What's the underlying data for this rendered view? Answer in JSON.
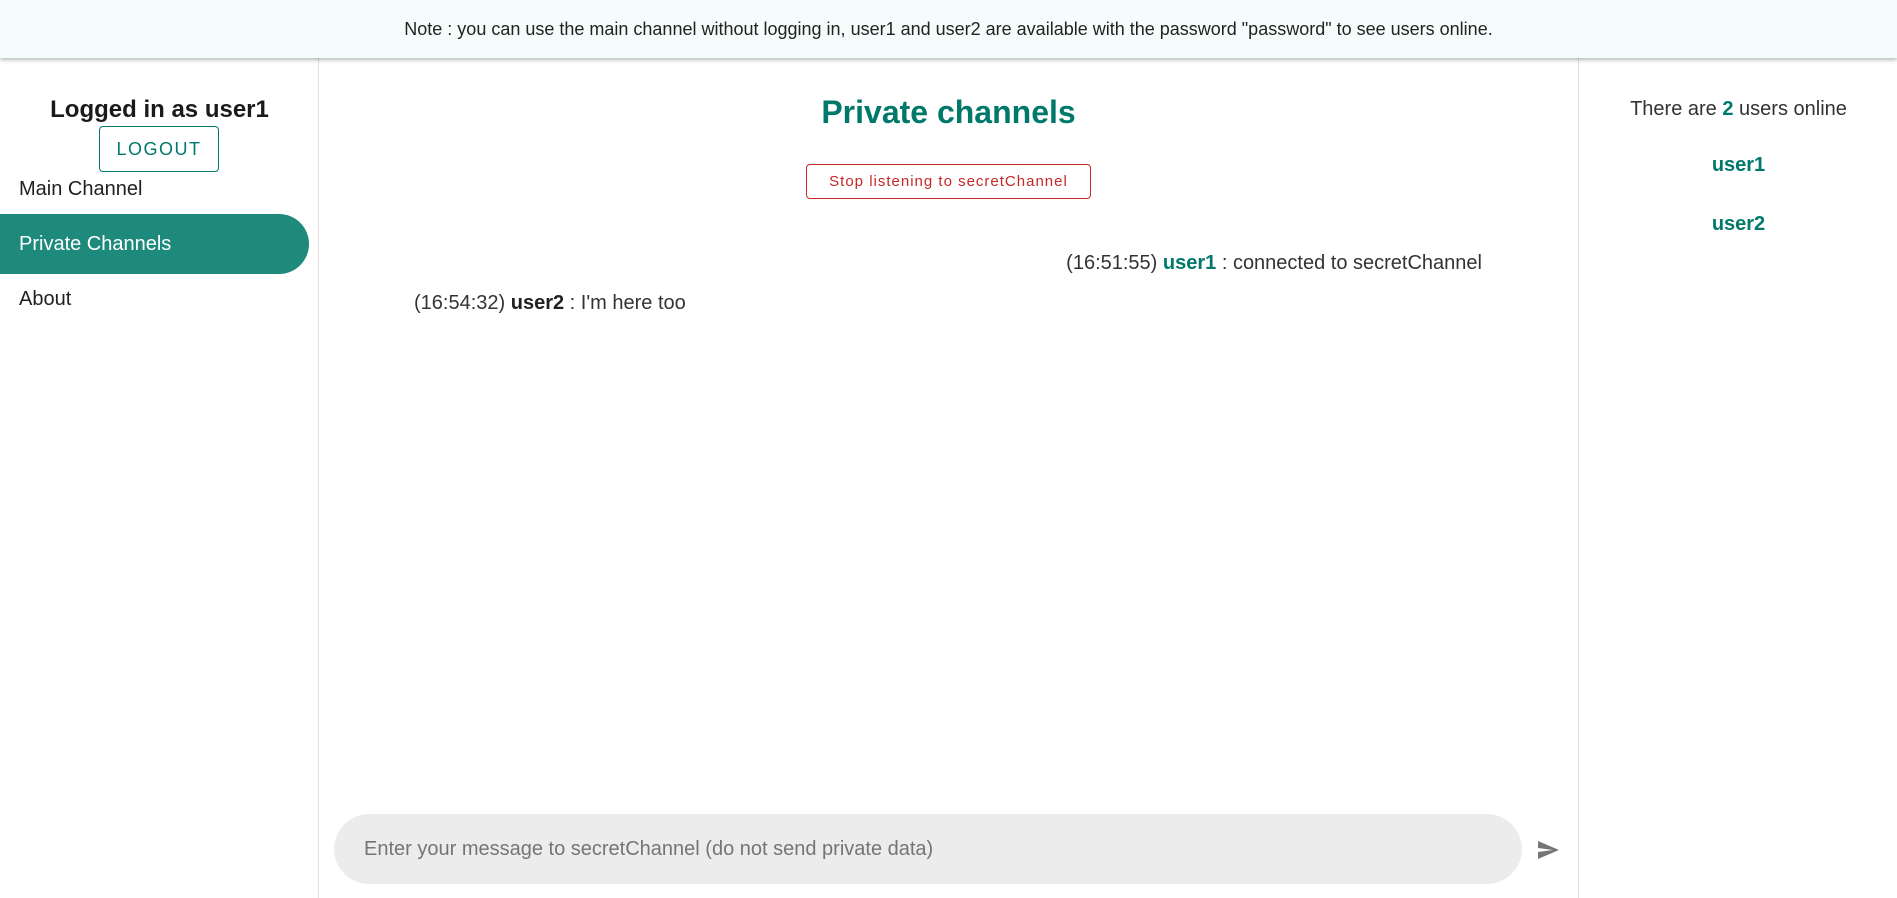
{
  "banner": {
    "note": "Note : you can use the main channel without logging in, user1 and user2 are available with the password \"password\" to see users online."
  },
  "sidebar": {
    "logged_in_text": "Logged in as user1",
    "logout_label": "LOGOUT",
    "items": [
      {
        "label": "Main Channel",
        "active": false
      },
      {
        "label": "Private Channels",
        "active": true
      },
      {
        "label": "About",
        "active": false
      }
    ]
  },
  "main": {
    "title": "Private channels",
    "stop_button_label": "Stop listening to secretChannel",
    "messages": [
      {
        "time": "(16:51:55)",
        "user": "user1",
        "separator": " : ",
        "text": "connected to secretChannel",
        "align": "right"
      },
      {
        "time": "(16:54:32)",
        "user": "user2",
        "separator": " : ",
        "text": "I'm here too",
        "align": "left"
      }
    ],
    "input": {
      "placeholder": "Enter your message to secretChannel (do not send private data)",
      "value": ""
    },
    "send_icon": "send-icon"
  },
  "right_panel": {
    "online_prefix": "There are ",
    "online_count": "2",
    "online_suffix": " users online",
    "users": [
      "user1",
      "user2"
    ]
  },
  "colors": {
    "accent": "#00796b",
    "active_nav": "#1e8a7c",
    "danger": "#c62828",
    "banner_bg": "#f5fdfc",
    "input_bg": "#ececec"
  }
}
